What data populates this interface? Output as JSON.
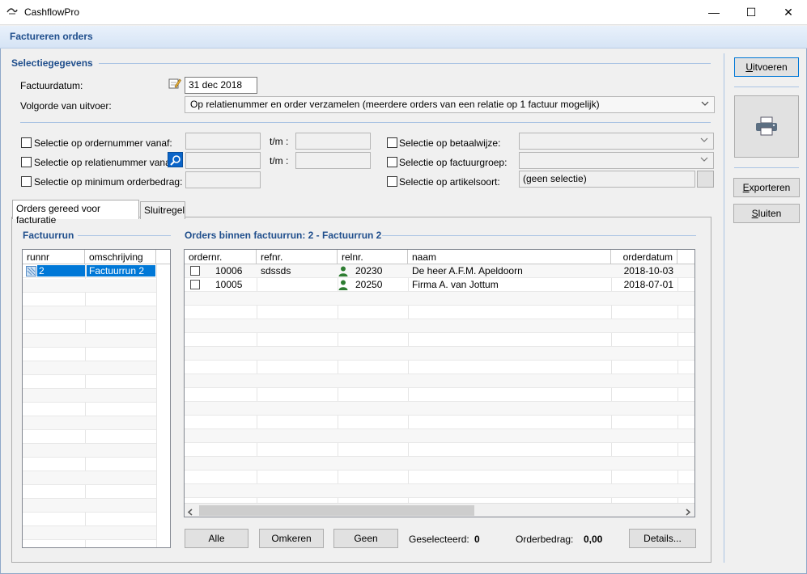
{
  "window": {
    "app_title": "CashflowPro",
    "minimize_glyph": "—",
    "maximize_glyph": "☐",
    "close_glyph": "✕"
  },
  "header": {
    "title": "Factureren orders"
  },
  "selection": {
    "section_title": "Selectiegegevens",
    "invoice_date_label": "Factuurdatum:",
    "invoice_date_value": "31 dec 2018",
    "order_label": "Volgorde van uitvoer:",
    "order_value": "Op relatienummer en order verzamelen (meerdere orders van een relatie op 1 factuur mogelijk)",
    "filters": {
      "ordernr_label": "Selectie op ordernummer vanaf:",
      "relnr_label": "Selectie op relatienummer vanaf:",
      "min_amount_label": "Selectie op minimum orderbedrag:",
      "tm_label_1": "t/m :",
      "tm_label_2": "t/m :",
      "payment_label": "Selectie op betaalwijze:",
      "invoicegroup_label": "Selectie op factuurgroep:",
      "articletype_label": "Selectie op artikelsoort:",
      "articletype_value": "(geen selectie)"
    }
  },
  "tabs": [
    {
      "label": "Orders gereed voor facturatie"
    },
    {
      "label": "Sluitregel"
    }
  ],
  "runs": {
    "title": "Factuurrun",
    "columns": [
      "runnr",
      "omschrijving"
    ],
    "rows": [
      {
        "runnr": "2",
        "omschrijving": "Factuurrun 2"
      }
    ]
  },
  "orders": {
    "title": "Orders binnen factuurrun: 2 - Factuurrun 2",
    "columns": [
      "ordernr.",
      "refnr.",
      "relnr.",
      "naam",
      "orderdatum"
    ],
    "rows": [
      {
        "ordernr": "10006",
        "refnr": "sdssds",
        "relnr": "20230",
        "naam": "De heer A.F.M. Apeldoorn",
        "orderdatum": "2018-10-03"
      },
      {
        "ordernr": "10005",
        "refnr": "",
        "relnr": "20250",
        "naam": "Firma A. van Jottum",
        "orderdatum": "2018-07-01"
      }
    ]
  },
  "bottom": {
    "all_label": "Alle",
    "invert_label": "Omkeren",
    "none_label": "Geen",
    "selected_label": "Geselecteerd:",
    "selected_value": "0",
    "amount_label": "Orderbedrag:",
    "amount_value": "0,00",
    "details_label": "Details..."
  },
  "side": {
    "execute_label": "Uitvoeren",
    "export_label": "Exporteren",
    "close_label": "Sluiten"
  },
  "icons": {
    "app": "cashflow-logo-icon",
    "calendar": "calendar-pencil-icon",
    "lookup": "magnifier-icon",
    "printer": "printer-icon",
    "person": "person-icon",
    "grid_row": "row-indicator-icon"
  },
  "colors": {
    "section_title": "#1f4e8c",
    "selection": "#0078d7",
    "person_icon": "#2e7d32"
  }
}
